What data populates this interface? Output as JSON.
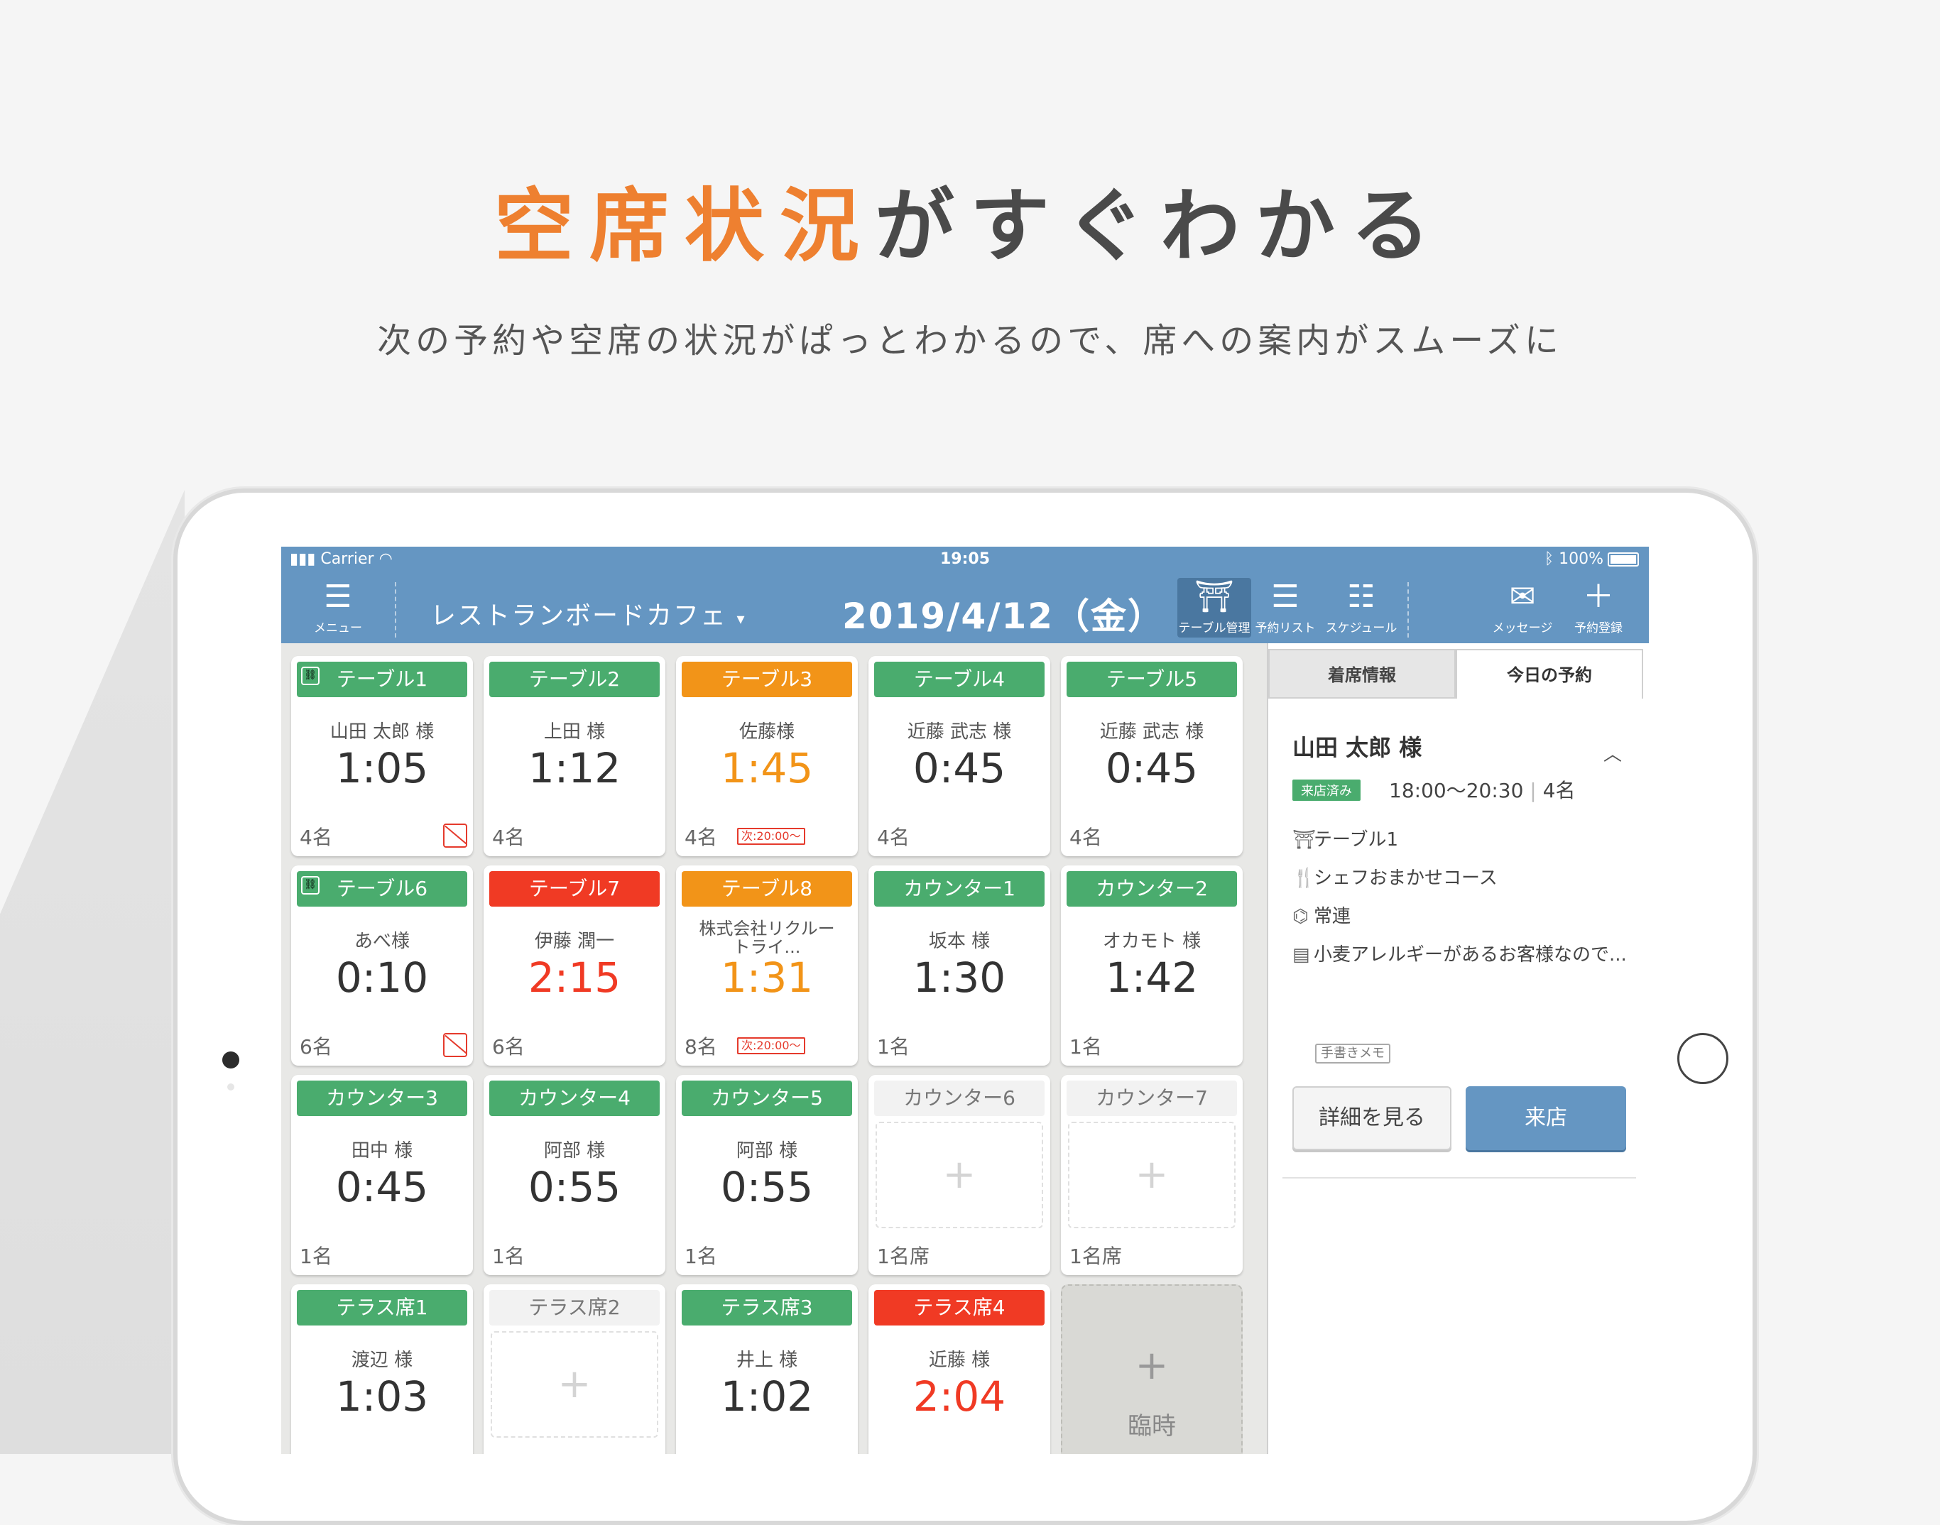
{
  "headline": {
    "accent": "空席状況",
    "rest": "がすぐわかる"
  },
  "subheadline": "次の予約や空席の状況がぱっとわかるので、席への案内がスムーズに",
  "status_bar": {
    "carrier": "Carrier",
    "time": "19:05",
    "battery": "100%"
  },
  "nav": {
    "menu_label": "メニュー",
    "restaurant": "レストランボードカフェ",
    "date": "2019/4/12（金）",
    "buttons": [
      {
        "label": "テーブル管理",
        "icon": "table-icon"
      },
      {
        "label": "予約リスト",
        "icon": "list-icon"
      },
      {
        "label": "スケジュール",
        "icon": "schedule-icon"
      },
      {
        "label": "メッセージ",
        "icon": "mail-icon"
      },
      {
        "label": "予約登録",
        "icon": "plus-icon"
      }
    ]
  },
  "tables": [
    {
      "name": "テーブル1",
      "status": "green",
      "guest": "山田 太郎 様",
      "time": "1:05",
      "time_color": "normal",
      "count": "4名",
      "link": true,
      "nosmoke": true
    },
    {
      "name": "テーブル2",
      "status": "green",
      "guest": "上田 様",
      "time": "1:12",
      "time_color": "normal",
      "count": "4名"
    },
    {
      "name": "テーブル3",
      "status": "orange",
      "guest": "佐藤様",
      "time": "1:45",
      "time_color": "orange",
      "count": "4名",
      "next": "次:20:00〜"
    },
    {
      "name": "テーブル4",
      "status": "green",
      "guest": "近藤 武志 様",
      "time": "0:45",
      "time_color": "normal",
      "count": "4名"
    },
    {
      "name": "テーブル5",
      "status": "green",
      "guest": "近藤 武志 様",
      "time": "0:45",
      "time_color": "normal",
      "count": "4名"
    },
    {
      "name": "テーブル6",
      "status": "green",
      "guest": "あべ様",
      "time": "0:10",
      "time_color": "normal",
      "count": "6名",
      "link": true,
      "nosmoke": true
    },
    {
      "name": "テーブル7",
      "status": "red",
      "guest": "伊藤 潤一",
      "time": "2:15",
      "time_color": "red",
      "count": "6名"
    },
    {
      "name": "テーブル8",
      "status": "orange",
      "guest": "株式会社リクルートライ...",
      "time": "1:31",
      "time_color": "orange",
      "count": "8名",
      "next": "次:20:00〜"
    },
    {
      "name": "カウンター1",
      "status": "green",
      "guest": "坂本 様",
      "time": "1:30",
      "time_color": "normal",
      "count": "1名"
    },
    {
      "name": "カウンター2",
      "status": "green",
      "guest": "オカモト 様",
      "time": "1:42",
      "time_color": "normal",
      "count": "1名"
    },
    {
      "name": "カウンター3",
      "status": "green",
      "guest": "田中 様",
      "time": "0:45",
      "time_color": "normal",
      "count": "1名"
    },
    {
      "name": "カウンター4",
      "status": "green",
      "guest": "阿部 様",
      "time": "0:55",
      "time_color": "normal",
      "count": "1名"
    },
    {
      "name": "カウンター5",
      "status": "green",
      "guest": "阿部 様",
      "time": "0:55",
      "time_color": "normal",
      "count": "1名"
    },
    {
      "name": "カウンター6",
      "status": "empty",
      "count": "1名席"
    },
    {
      "name": "カウンター7",
      "status": "empty",
      "count": "1名席"
    },
    {
      "name": "テラス席1",
      "status": "green",
      "guest": "渡辺 様",
      "time": "1:03",
      "time_color": "normal"
    },
    {
      "name": "テラス席2",
      "status": "empty"
    },
    {
      "name": "テラス席3",
      "status": "green",
      "guest": "井上 様",
      "time": "1:02",
      "time_color": "normal"
    },
    {
      "name": "テラス席4",
      "status": "red",
      "guest": "近藤 様",
      "time": "2:04",
      "time_color": "red"
    },
    {
      "name": "臨時",
      "status": "temp"
    }
  ],
  "panel": {
    "tab_seated": "着席情報",
    "tab_today": "今日の予約",
    "reservation": {
      "name": "山田 太郎 様",
      "badge": "来店済み",
      "time_range": "18:00〜20:30",
      "people": "4名",
      "table": "テーブル1",
      "course": "シェフおまかせコース",
      "tag": "常連",
      "memo": "小麦アレルギーがあるお客様なので...",
      "memo_tag": "手書きメモ"
    },
    "detail_button": "詳細を見る",
    "visit_button": "来店"
  }
}
